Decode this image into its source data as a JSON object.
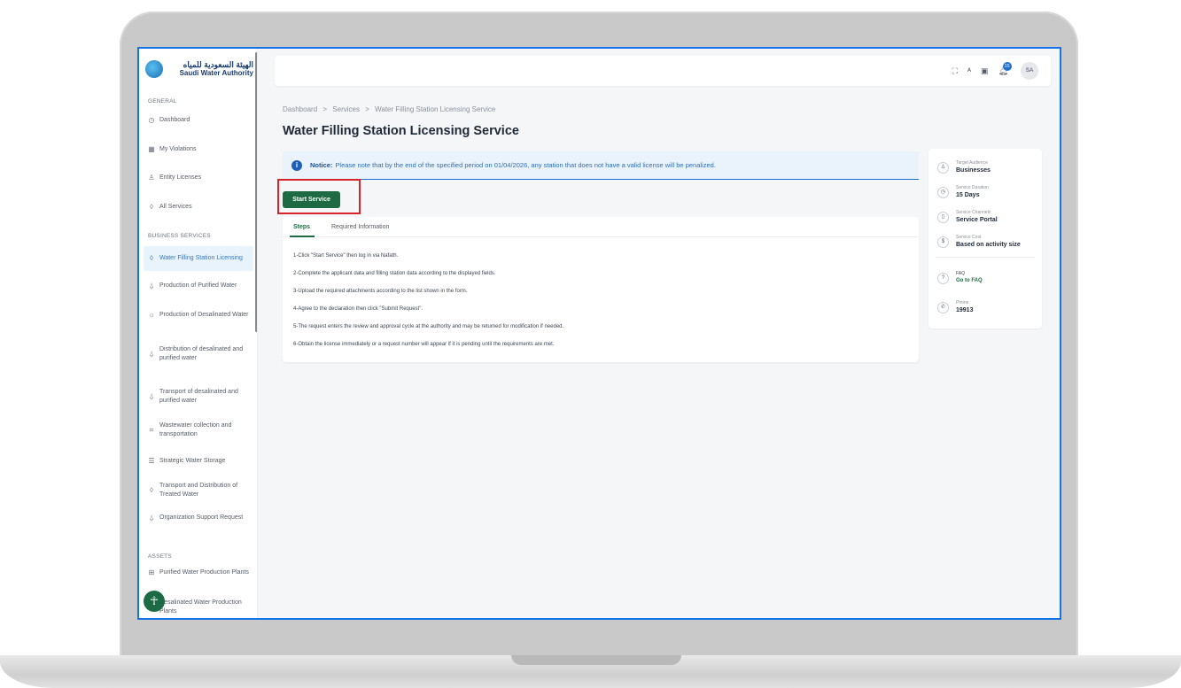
{
  "sidebar": {
    "logo_ar": "الهيئة السعودية للمياه",
    "logo_en": "Saudi Water Authority",
    "section_general": "GENERAL",
    "general_items": [
      {
        "label": "Dashboard",
        "icon": "gauge-icon"
      },
      {
        "label": "My Violations",
        "icon": "grid-icon"
      },
      {
        "label": "Entity Licenses",
        "icon": "user-icon"
      },
      {
        "label": "All Services",
        "icon": "drop-icon"
      }
    ],
    "section_business": "BUSINESS SERVICES",
    "business_items": [
      {
        "label": "Water Filling Station Licensing",
        "icon": "drop-icon"
      },
      {
        "label": "Production of Purified Water",
        "icon": "bottle-icon"
      },
      {
        "label": "Production of Desalinated Water",
        "icon": "sun-icon"
      },
      {
        "label": "Distribution of desalinated and purified water",
        "icon": "bottle-icon"
      },
      {
        "label": "Transport of desalinated and purified water",
        "icon": "bottle-icon"
      },
      {
        "label": "Wastewater collection and transportation",
        "icon": "pipes-icon"
      },
      {
        "label": "Strategic Water Storage",
        "icon": "storage-icon"
      },
      {
        "label": "Transport and Distribution of Treated Water",
        "icon": "drop-icon"
      },
      {
        "label": "Organization Support Request",
        "icon": "bottle-icon"
      }
    ],
    "section_assets": "ASSETS",
    "asset_items": [
      {
        "label": "Purified Water Production Plants",
        "icon": "plant-icon"
      },
      {
        "label": "Desalinated Water Production Plants",
        "icon": "plant-icon"
      }
    ],
    "accessibility_glyph": "☥"
  },
  "topbar": {
    "notification_count": "15",
    "avatar_initials": "SA"
  },
  "main": {
    "breadcrumb": [
      "Dashboard",
      ">",
      "Services",
      ">",
      "Water Filling Station Licensing Service"
    ],
    "title": "Water Filling Station Licensing Service",
    "notice_label": "Notice:",
    "notice_text": "Please note that by the end of the specified period on 01/04/2026, any station that does not have a valid license will be penalized.",
    "start_button": "Start Service",
    "tabs": [
      "Steps",
      "Required Information"
    ],
    "steps": [
      "1-Click \"Start Service\" then log in via Nafath.",
      "2-Complete the applicant data and filling station data according to the displayed fields.",
      "3-Upload the required attachments according to the list shown in the form.",
      "4-Agree to the declaration then click \"Submit Request\".",
      "5-The request enters the review and approval cycle at the authority and may be returned for modification if needed.",
      "6-Obtain the license immediately or a request number will appear if it is pending until the requirements are met."
    ]
  },
  "service_info": {
    "target_audience_label": "Target Audience",
    "target_audience_value": "Businesses",
    "duration_label": "Service Duration",
    "duration_value": "15 Days",
    "channels_label": "Service Channels",
    "channels_value": "Service Portal",
    "cost_label": "Service Cost",
    "cost_value": "Based on activity size",
    "faq_label": "FAQ",
    "faq_link": "Go to FAQ",
    "phone_label": "Phone",
    "phone_value": "19913"
  },
  "colors": {
    "primary_green": "#1e6b43",
    "highlight_red": "#d9232a",
    "screen_border_blue": "#1473e6"
  }
}
